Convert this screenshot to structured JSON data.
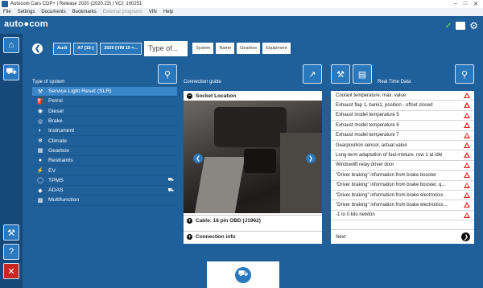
{
  "window": {
    "title": "Autocom Cars CDP+ | Release 2020 (2020.23) | VCI: 100251"
  },
  "menu": [
    "File",
    "Settings",
    "Documents",
    "Bookmarks",
    "External programs",
    "VIN",
    "Help"
  ],
  "app": {
    "logo": "auto●com"
  },
  "vehicle": {
    "make": "Audi",
    "model": "A7 [15-]",
    "year": "2020 (VIN 10 =...",
    "type_placeholder": "Type of...",
    "tabs": [
      "System",
      "Name",
      "Gearbox",
      "Equipment"
    ]
  },
  "systems": {
    "header": "Type of system",
    "items": [
      {
        "label": "Service Light Reset (SLR)",
        "icon": "wrench-icon",
        "selected": true
      },
      {
        "label": "Petrol",
        "icon": "fuel-icon"
      },
      {
        "label": "Diesel",
        "icon": "diesel-icon"
      },
      {
        "label": "Brake",
        "icon": "brake-icon"
      },
      {
        "label": "Instrument",
        "icon": "instrument-icon"
      },
      {
        "label": "Climate",
        "icon": "climate-icon"
      },
      {
        "label": "Gearbox",
        "icon": "gearbox-icon"
      },
      {
        "label": "Restraints",
        "icon": "airbag-icon"
      },
      {
        "label": "EV",
        "icon": "ev-icon"
      },
      {
        "label": "TPMS",
        "icon": "tpms-icon"
      },
      {
        "label": "ADAS",
        "icon": "adas-icon"
      },
      {
        "label": "Multifunction",
        "icon": "multifunction-icon"
      }
    ]
  },
  "guide": {
    "header": "Connection guide",
    "socket_location": "Socket Location",
    "cable": "Cable: 16 pin OBD (J1962)",
    "connection_info": "Connection info"
  },
  "rtd": {
    "header": "Real Time Data",
    "items": [
      "Coolant temperature, max. value",
      "Exhaust flap 1, bank1, position - offset closed",
      "Exhaust model temperature 5",
      "Exhaust model temperature 6",
      "Exhaust model temperature 7",
      "Gearposition sensor, actual value",
      "Long-term adaptation of fuel-mixture, row 1 at idle",
      "Windowlift relay driver door",
      "\"Driver braking\" information from brake booster",
      "\"Driver braking\" information from brake booster, q...",
      "\"Driver braking\" information from brake electronics",
      "\"Driver braking\" information from brake electronics...",
      "-1 to 0 kilo newton"
    ],
    "next": "Next"
  },
  "colors": {
    "background": "#1f5f9a",
    "accent": "#2a78bd",
    "selected": "#3a86c8",
    "warning": "#d8231d"
  }
}
